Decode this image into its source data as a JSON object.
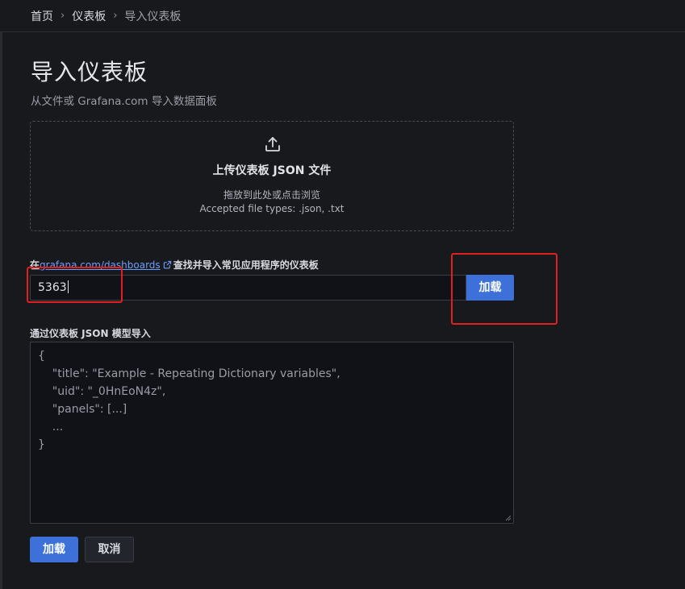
{
  "breadcrumb": {
    "home": "首页",
    "dashboards": "仪表板",
    "current": "导入仪表板"
  },
  "page": {
    "title": "导入仪表板",
    "subtitle": "从文件或 Grafana.com 导入数据面板"
  },
  "upload": {
    "title": "上传仪表板 JSON 文件",
    "hint": "拖放到此处或点击浏览",
    "types": "Accepted file types: .json, .txt"
  },
  "grafana_com": {
    "label_prefix": "在",
    "link_text": "grafana.com/dashboards",
    "label_suffix": "查找并导入常见应用程序的仪表板",
    "input_value": "5363",
    "load_label": "加载"
  },
  "json_model": {
    "label": "通过仪表板 JSON 模型导入",
    "placeholder": "{\n    \"title\": \"Example - Repeating Dictionary variables\",\n    \"uid\": \"_0HnEoN4z\",\n    \"panels\": [...]\n    ...\n}"
  },
  "actions": {
    "load_label": "加载",
    "cancel_label": "取消"
  },
  "colors": {
    "background": "#18191d",
    "primary": "#3d71d9",
    "link": "#6e9fff",
    "annotation_red": "#e02020"
  }
}
